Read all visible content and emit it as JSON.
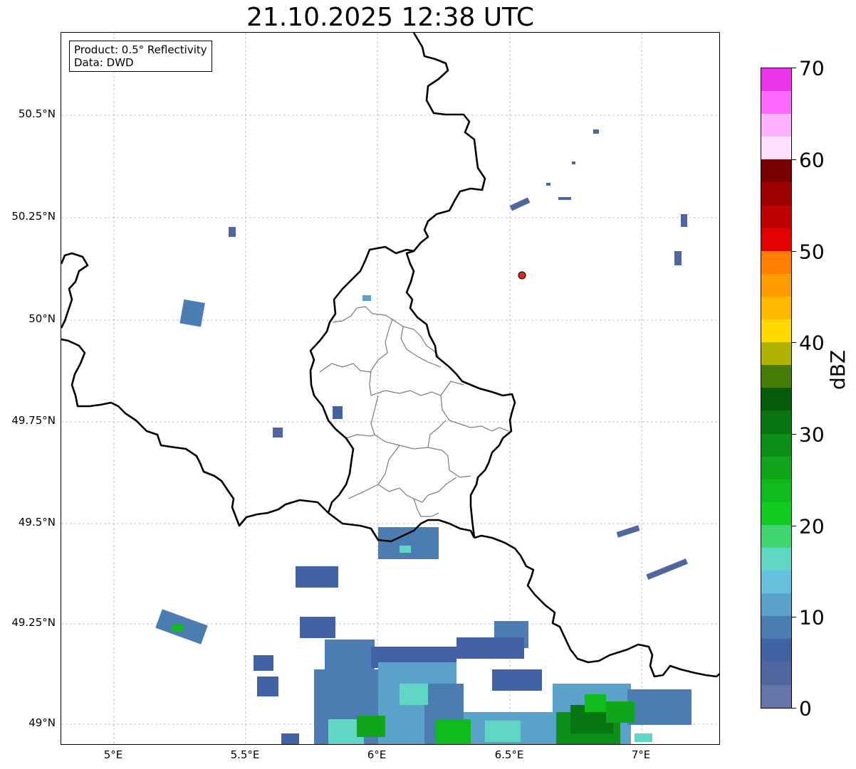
{
  "title": "21.10.2025 12:38 UTC",
  "info": {
    "product": "Product: 0.5° Reflectivity",
    "data": "Data: DWD"
  },
  "lat_labels": [
    "50.5°N",
    "50.25°N",
    "50°N",
    "49.75°N",
    "49.5°N",
    "49.25°N",
    "49°N"
  ],
  "lon_labels": [
    "5°E",
    "5.5°E",
    "6°E",
    "6.5°E",
    "7°E"
  ],
  "colorbar": {
    "label": "dBZ",
    "ticks": [
      "70",
      "60",
      "50",
      "40",
      "30",
      "20",
      "10",
      "0"
    ],
    "colors": [
      "#ec34ec",
      "#fd6afd",
      "#feb2fe",
      "#ffe0ff",
      "#7a0000",
      "#9c0000",
      "#be0000",
      "#e20000",
      "#ff7f00",
      "#ff9c00",
      "#ffba00",
      "#ffd800",
      "#b1b100",
      "#457c08",
      "#045c0a",
      "#077610",
      "#0c8f16",
      "#10a51b",
      "#10bb1c",
      "#10cc1f",
      "#3fd671",
      "#5fd7c4",
      "#65c1dd",
      "#5aa2ca",
      "#4b7db3",
      "#4262a6",
      "#4f669f",
      "#6675a9"
    ]
  },
  "station_marker": {
    "color": "#e8231e"
  },
  "colors": {
    "border": "#000000",
    "district": "#7a7a7a",
    "grid": "#b0b0b0"
  }
}
